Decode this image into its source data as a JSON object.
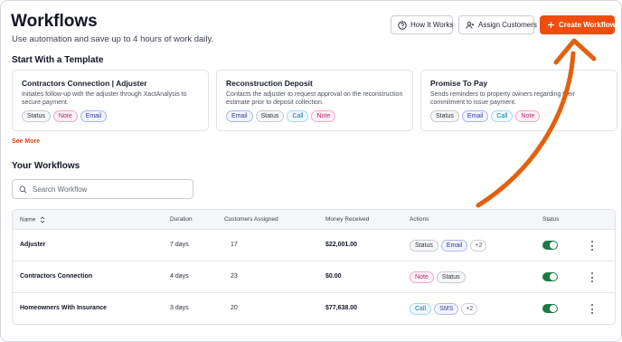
{
  "header": {
    "title": "Workflows",
    "subtitle": "Use automation and save up to 4 hours of work daily.",
    "how_it_works": "How It Works",
    "assign_customers": "Assign Customers",
    "create_workflow": "Create Workflow"
  },
  "templates": {
    "heading": "Start With a Template",
    "see_more": "See More",
    "cards": [
      {
        "title": "Contractors Connection | Adjuster",
        "description": "Initiates follow-up with the adjuster through XactAnalysis to secure payment.",
        "tags": [
          "Status",
          "Note",
          "Email"
        ]
      },
      {
        "title": "Reconstruction Deposit",
        "description": "Contacts the adjuster to request approval on the reconstruction estimate prior to deposit collection.",
        "tags": [
          "Email",
          "Status",
          "Call",
          "Note"
        ]
      },
      {
        "title": "Promise To Pay",
        "description": "Sends reminders to property owners regarding their commitment to issue payment.",
        "tags": [
          "Status",
          "Email",
          "Call",
          "Note"
        ]
      }
    ]
  },
  "your_workflows": {
    "heading": "Your Workflows",
    "search_placeholder": "Search Workflow",
    "columns": [
      "Name",
      "Duration",
      "Customers Assigned",
      "Money Received",
      "Actions",
      "Status"
    ],
    "rows": [
      {
        "name": "Adjuster",
        "duration": "7 days",
        "customers": "17",
        "money": "$22,001.00",
        "actions": [
          "Status",
          "Email"
        ],
        "more": "+2",
        "active": true
      },
      {
        "name": "Contractors Connection",
        "duration": "4 days",
        "customers": "23",
        "money": "$0.00",
        "actions": [
          "Note",
          "Status"
        ],
        "more": "",
        "active": true
      },
      {
        "name": "Homeowners With Insurance",
        "duration": "3 days",
        "customers": "20",
        "money": "$77,638.00",
        "actions": [
          "Call",
          "SMS"
        ],
        "more": "+2",
        "active": true
      }
    ]
  },
  "colors": {
    "accent": "#ef4d0f",
    "toggle_on": "#1d7a45"
  },
  "icons": [
    "question-circle-icon",
    "user-plus-icon",
    "plus-icon",
    "search-icon",
    "sort-icon",
    "kebab-menu-icon",
    "curved-arrow-annotation"
  ]
}
